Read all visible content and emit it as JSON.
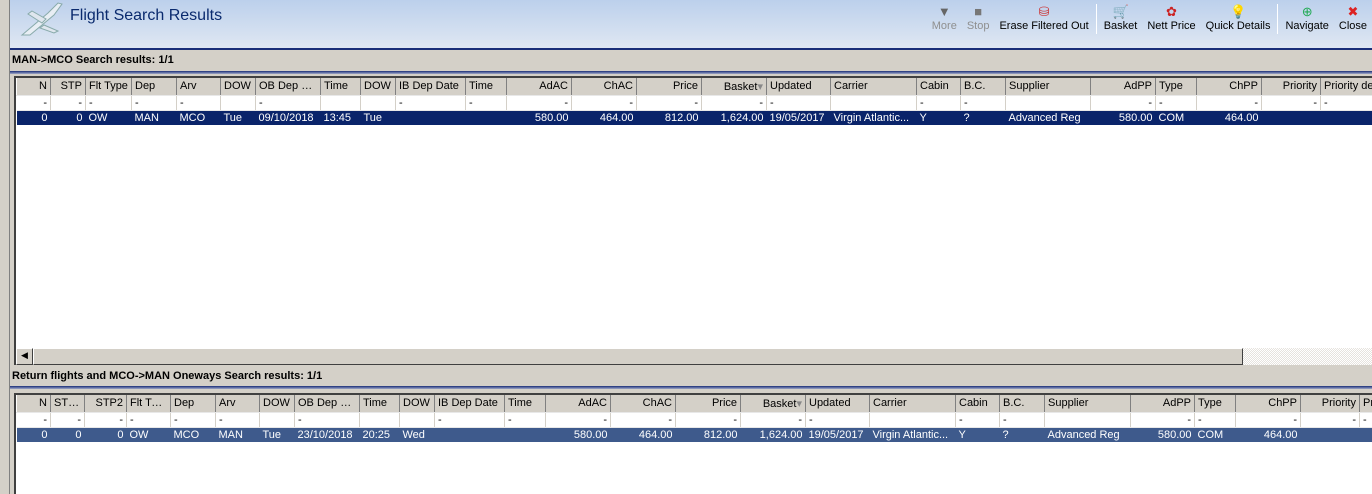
{
  "app": {
    "title": "Flight Search Results"
  },
  "toolbar": [
    {
      "label": "More",
      "icon": "triangle-down-icon",
      "enabled": false
    },
    {
      "label": "Stop",
      "icon": "stop-icon",
      "enabled": false
    },
    {
      "label": "Erase Filtered Out",
      "icon": "erase-filter-icon",
      "enabled": true
    },
    {
      "sep": true
    },
    {
      "label": "Basket",
      "icon": "basket-icon",
      "enabled": true
    },
    {
      "label": "Nett Price",
      "icon": "nett-price-icon",
      "enabled": true
    },
    {
      "label": "Quick Details",
      "icon": "lightbulb-icon",
      "enabled": true
    },
    {
      "sep": true
    },
    {
      "label": "Navigate",
      "icon": "compass-icon",
      "enabled": true
    },
    {
      "label": "Close",
      "icon": "close-icon",
      "enabled": true
    }
  ],
  "outbound": {
    "title": "MAN->MCO Search results: 1/1",
    "columns": [
      "N",
      "STP",
      "Flt Type",
      "Dep",
      "Arv",
      "DOW",
      "OB Dep D...",
      "Time",
      "DOW",
      "IB Dep Date",
      "Time",
      "AdAC",
      "ChAC",
      "Price",
      "Basket",
      "Updated",
      "Carrier",
      "Cabin",
      "B.C.",
      "Supplier",
      "AdPP",
      "Type",
      "ChPP",
      "Priority",
      "Priority de"
    ],
    "filters": [
      "-",
      "-",
      "-",
      "-",
      "-",
      "",
      "-",
      "",
      "",
      "-",
      "-",
      "-",
      "-",
      "-",
      "-",
      "-",
      "",
      "-",
      "-",
      "",
      "-",
      "-",
      "-",
      "-",
      "-"
    ],
    "rows": [
      [
        "0",
        "0",
        "OW",
        "MAN",
        "MCO",
        "Tue",
        "09/10/2018",
        "13:45",
        "Tue",
        "",
        "",
        "580.00",
        "464.00",
        "812.00",
        "1,624.00",
        "19/05/2017",
        "Virgin Atlantic...",
        "Y",
        "?",
        "Advanced Reg",
        "580.00",
        "COM",
        "464.00",
        "",
        ""
      ]
    ]
  },
  "return": {
    "title": "Return flights and MCO->MAN Oneways Search results: 1/1",
    "columns": [
      "N",
      "STP1",
      "STP2",
      "Flt Type",
      "Dep",
      "Arv",
      "DOW",
      "OB Dep D...",
      "Time",
      "DOW",
      "IB Dep Date",
      "Time",
      "AdAC",
      "ChAC",
      "Price",
      "Basket",
      "Updated",
      "Carrier",
      "Cabin",
      "B.C.",
      "Supplier",
      "AdPP",
      "Type",
      "ChPP",
      "Priority",
      "Pr"
    ],
    "filters": [
      "-",
      "-",
      "-",
      "-",
      "-",
      "-",
      "",
      "-",
      "",
      "",
      "-",
      "-",
      "-",
      "-",
      "-",
      "-",
      "-",
      "",
      "-",
      "-",
      "",
      "-",
      "-",
      "-",
      "-",
      "-"
    ],
    "rows": [
      [
        "0",
        "0",
        "0",
        "OW",
        "MCO",
        "MAN",
        "Tue",
        "23/10/2018",
        "20:25",
        "Wed",
        "",
        "",
        "580.00",
        "464.00",
        "812.00",
        "1,624.00",
        "19/05/2017",
        "Virgin Atlantic...",
        "Y",
        "?",
        "Advanced Reg",
        "580.00",
        "COM",
        "464.00",
        "",
        ""
      ]
    ]
  },
  "colors": {
    "selected_active": "#0a246a",
    "selected_inactive": "#3e5a8c",
    "accent": "#1a2e78"
  }
}
